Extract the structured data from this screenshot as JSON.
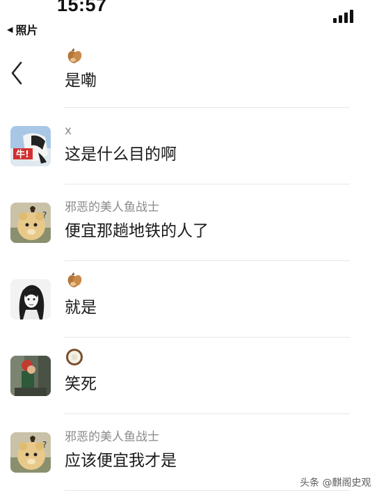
{
  "status_bar": {
    "time": "15:57",
    "back_label": "照片"
  },
  "comments": [
    {
      "name": "",
      "name_icon": "chestnut-icon",
      "text": "是嘞"
    },
    {
      "name": "x",
      "name_icon": "",
      "text": "这是什么目的啊"
    },
    {
      "name": "邪恶的美人鱼战士",
      "name_icon": "",
      "text": "便宜那趟地铁的人了"
    },
    {
      "name": "",
      "name_icon": "chestnut-icon",
      "text": "就是"
    },
    {
      "name": "",
      "name_icon": "coconut-icon",
      "text": "笑死"
    },
    {
      "name": "邪恶的美人鱼战士",
      "name_icon": "",
      "text": "应该便宜我才是"
    }
  ],
  "watermark": "头条 @麒阁史观"
}
